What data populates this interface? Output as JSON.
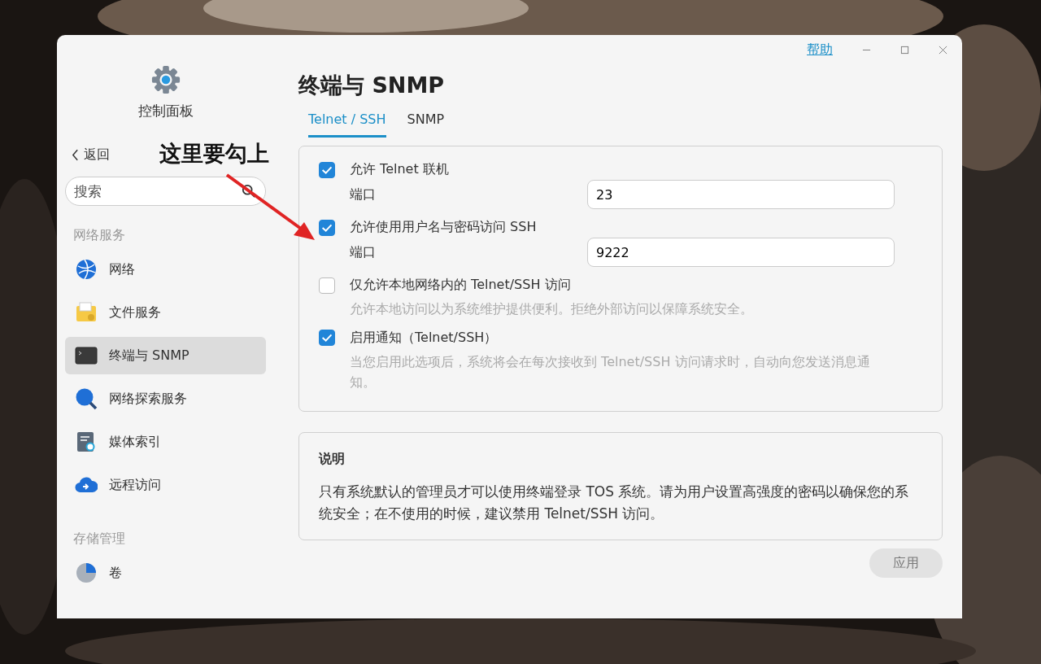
{
  "window": {
    "help": "帮助"
  },
  "sidebar": {
    "app_title": "控制面板",
    "back": "返回",
    "search": {
      "placeholder": "搜索"
    },
    "groups": [
      {
        "label": "网络服务",
        "items": [
          {
            "kind": "globe",
            "label": "网络",
            "selected": false
          },
          {
            "kind": "folder",
            "label": "文件服务",
            "selected": false
          },
          {
            "kind": "terminal",
            "label": "终端与 SNMP",
            "selected": true
          },
          {
            "kind": "magnifier",
            "label": "网络探索服务",
            "selected": false
          },
          {
            "kind": "media",
            "label": "媒体索引",
            "selected": false
          },
          {
            "kind": "cloud",
            "label": "远程访问",
            "selected": false
          }
        ]
      },
      {
        "label": "存储管理",
        "items": [
          {
            "kind": "pie",
            "label": "卷",
            "selected": false
          }
        ]
      }
    ]
  },
  "page_title": "终端与 SNMP",
  "tabs": [
    {
      "label": "Telnet / SSH",
      "selected": true
    },
    {
      "label": "SNMP",
      "selected": false
    }
  ],
  "options": [
    {
      "label": "允许 Telnet 联机",
      "checked": true,
      "port_label": "端口",
      "port": "23"
    },
    {
      "label": "允许使用用户名与密码访问 SSH",
      "checked": true,
      "port_label": "端口",
      "port": "9222"
    },
    {
      "label": "仅允许本地网络内的 Telnet/SSH 访问",
      "checked": false,
      "description": "允许本地访问以为系统维护提供便利。拒绝外部访问以保障系统安全。"
    },
    {
      "label": "启用通知（Telnet/SSH）",
      "checked": true,
      "description": "当您启用此选项后，系统将会在每次接收到 Telnet/SSH 访问请求时，自动向您发送消息通知。"
    }
  ],
  "note": {
    "title": "说明",
    "text": "只有系统默认的管理员才可以使用终端登录 TOS 系统。请为用户设置高强度的密码以确保您的系统安全；在不使用的时候，建议禁用 Telnet/SSH 访问。"
  },
  "apply": {
    "label": "应用",
    "disabled": true
  },
  "annotation": {
    "text": "这里要勾上"
  }
}
